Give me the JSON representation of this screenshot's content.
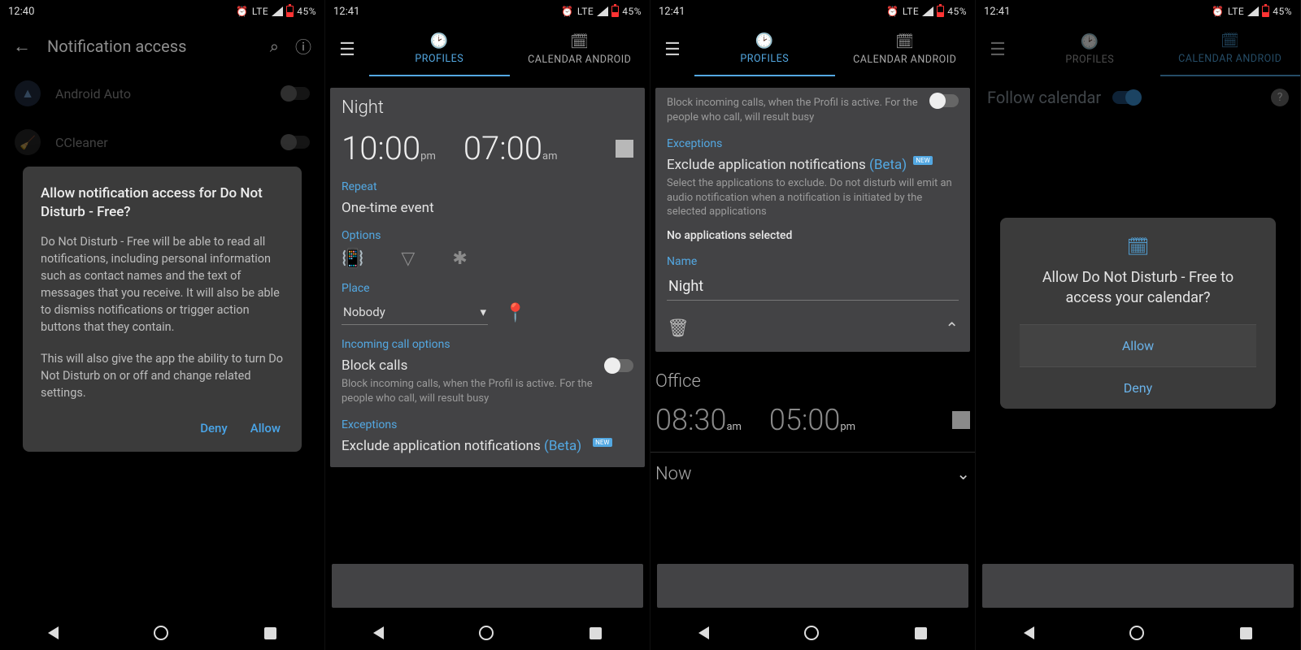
{
  "status": {
    "t1": "12:40",
    "t2": "12:41",
    "lte": "LTE",
    "batt": "45%"
  },
  "s1": {
    "title": "Notification access",
    "apps": [
      {
        "name": "Android Auto"
      },
      {
        "name": "CCleaner"
      }
    ],
    "dlg_title": "Allow notification access for Do Not Disturb - Free?",
    "dlg_p1": "Do Not Disturb - Free will be able to read all notifications, including personal information such as contact names and the text of messages that you receive. It will also be able to dismiss notifications or trigger action buttons that they contain.",
    "dlg_p2": "This will also give the app the ability to turn Do Not Disturb on or off and change related settings.",
    "deny": "Deny",
    "allow": "Allow"
  },
  "tabs": {
    "profiles": "PROFILES",
    "calendar": "CALENDAR ANDROID"
  },
  "s2": {
    "name": "Night",
    "t_from": "10:00",
    "t_from_suf": "pm",
    "t_to": "07:00",
    "t_to_suf": "am",
    "repeat_h": "Repeat",
    "repeat_v": "One-time event",
    "options_h": "Options",
    "place_h": "Place",
    "place_v": "Nobody",
    "inc_h": "Incoming call options",
    "block_t": "Block calls",
    "block_d": "Block incoming calls, when the Profil is active. For the people who call, will result busy",
    "exc_h": "Exceptions",
    "exc_t": "Exclude application notifications ",
    "beta": "(Beta)",
    "new": "NEW"
  },
  "s3": {
    "block_d": "Block incoming calls, when the Profil is active. For the people who call, will result busy",
    "exc_h": "Exceptions",
    "exc_t": "Exclude application notifications ",
    "beta": "(Beta)",
    "new": "NEW",
    "exc_d": "Select the applications to exclude. Do not disturb will emit an audio notification when a notification is initiated by the selected applications",
    "noapp": "No applications selected",
    "name_h": "Name",
    "name_v": "Night",
    "office": "Office",
    "of": "08:30",
    "ofs": "am",
    "ot": "05:00",
    "ots": "pm",
    "now": "Now"
  },
  "s4": {
    "follow": "Follow calendar",
    "msg": "Allow Do Not Disturb - Free to access your calendar?",
    "allow": "Allow",
    "deny": "Deny"
  }
}
